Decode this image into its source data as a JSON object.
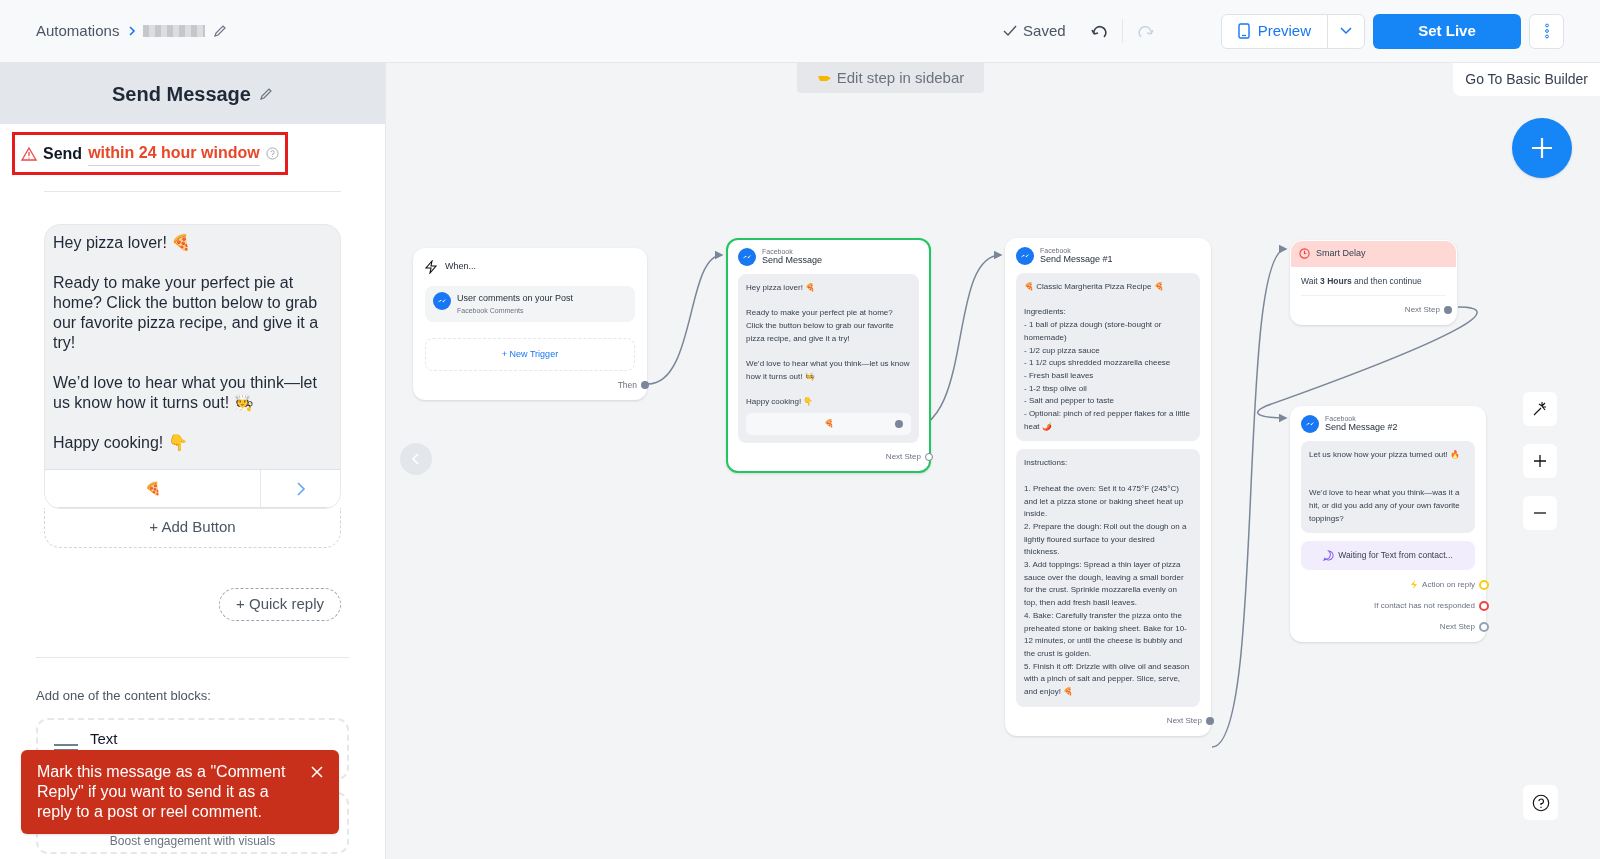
{
  "top_bar": {
    "breadcrumb": "Automations",
    "status": "Saved",
    "undo_disabled": false,
    "redo_disabled": true,
    "preview_label": "Preview",
    "set_live_label": "Set Live"
  },
  "sidebar": {
    "title": "Send Message",
    "warning_prefix": "Send",
    "warning_link": "within 24 hour window",
    "message": "Hey pizza lover! 🍕\n\nReady to make your perfect pie at home? Click the button below to grab our favorite pizza recipe, and give it a try!\n\nWe’d love to hear what you think—let us know how it turns out! 🧑‍🍳\n\nHappy cooking! 👇",
    "button_label": "🍕",
    "add_button": "+ Add Button",
    "quick_reply": "+ Quick reply",
    "blocks_heading": "Add one of the content blocks:",
    "blocks": [
      {
        "title": "Text"
      },
      {
        "subtitle": "Boost engagement with visuals"
      }
    ],
    "toast": "Mark this message as a \"Comment Reply\" if you want to send it as a reply to a post or reel comment."
  },
  "canvas": {
    "edit_hint": "Edit step in sidebar",
    "basic_builder": "Go To Basic Builder",
    "trigger": {
      "title": "When...",
      "event": "User comments on your Post",
      "source": "Facebook Comments",
      "new_trigger": "+ New Trigger",
      "output": "Then"
    },
    "steps": [
      {
        "kind": "message",
        "selected": true,
        "channel": "Facebook",
        "title": "Send Message",
        "bubbles": [
          "Hey pizza lover! 🍕\n\nReady to make your perfect pie at home? Click the button below to grab our favorite pizza recipe, and give it a try!\n\nWe’d love to hear what you think—let us know how it turns out! 🧑‍🍳\n\nHappy cooking! 👇"
        ],
        "button": "🍕",
        "output": "Next Step"
      },
      {
        "kind": "message",
        "selected": false,
        "channel": "Facebook",
        "title": "Send Message #1",
        "bubbles": [
          "🍕 Classic Margherita Pizza Recipe 🍕\n\nIngredients:\n- 1 ball of pizza dough (store-bought or homemade)\n- 1/2 cup pizza sauce\n- 1 1/2 cups shredded mozzarella cheese\n- Fresh basil leaves\n- 1-2 tbsp olive oil\n- Salt and pepper to taste\n- Optional: pinch of red pepper flakes for a little heat 🌶️",
          "Instructions:\n\n1. Preheat the oven: Set it to 475°F (245°C) and let a pizza stone or baking sheet heat up inside.\n2. Prepare the dough: Roll out the dough on a lightly floured surface to your desired thickness.\n3. Add toppings: Spread a thin layer of pizza sauce over the dough, leaving a small border for the crust. Sprinkle mozzarella evenly on top, then add fresh basil leaves.\n4. Bake: Carefully transfer the pizza onto the preheated stone or baking sheet. Bake for 10-12 minutes, or until the cheese is bubbly and the crust is golden.\n5. Finish it off: Drizzle with olive oil and season with a pinch of salt and pepper. Slice, serve, and enjoy! 🍕"
        ],
        "output": "Next Step"
      },
      {
        "kind": "delay",
        "selected": false,
        "title": "Smart Delay",
        "text": "Wait **3 Hours** and then continue",
        "output": "Next Step"
      },
      {
        "kind": "message",
        "selected": false,
        "channel": "Facebook",
        "title": "Send Message #2",
        "bubbles": [
          "Let us know how your pizza turned out! 🔥\n\n\nWe'd love to hear what you think—was it a hit, or did you add any of your own favorite toppings?"
        ],
        "waiting": "Waiting for Text from contact...",
        "outputs": [
          {
            "label": "Action on reply",
            "color": "#facc15",
            "icon": true
          },
          {
            "label": "If contact has not responded",
            "color": "#ef4444",
            "icon": false
          },
          {
            "label": "Next Step",
            "color": "#94a3b8",
            "icon": false
          }
        ]
      }
    ]
  }
}
